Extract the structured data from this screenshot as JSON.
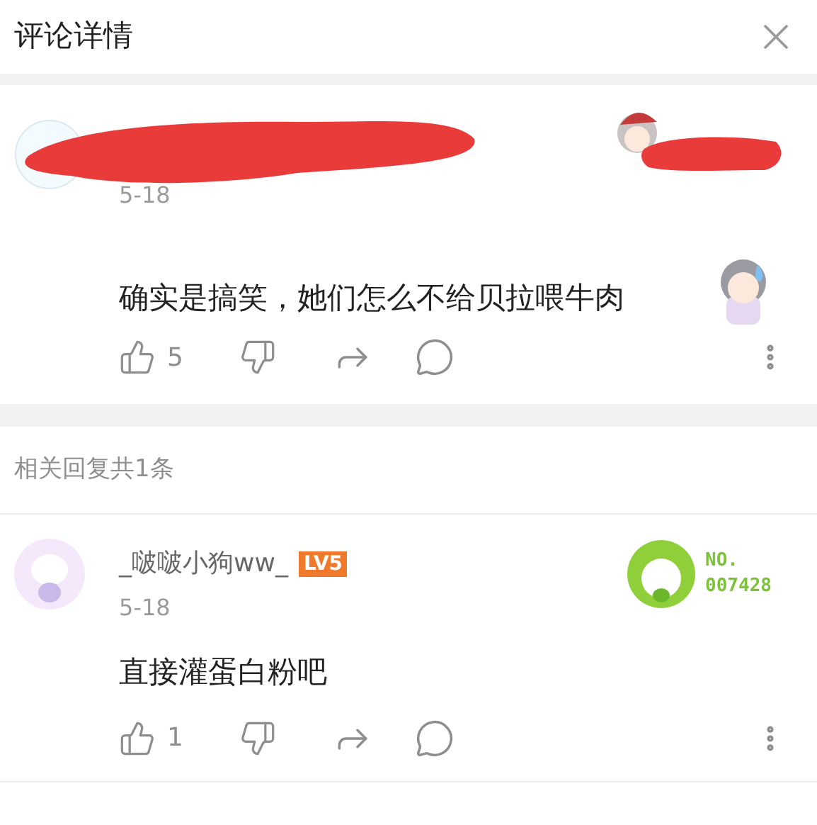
{
  "header": {
    "title": "评论详情"
  },
  "comment": {
    "date": "5-18",
    "text": "确实是搞笑，她们怎么不给贝拉喂牛肉",
    "likes": "5"
  },
  "replies_heading": "相关回复共1条",
  "replies": [
    {
      "name": "_啵啵小狗ww_",
      "level": "LV5",
      "fan_badge": [
        "NO.",
        "007428"
      ],
      "date": "5-18",
      "text": "直接灌蛋白粉吧",
      "likes": "1"
    }
  ]
}
